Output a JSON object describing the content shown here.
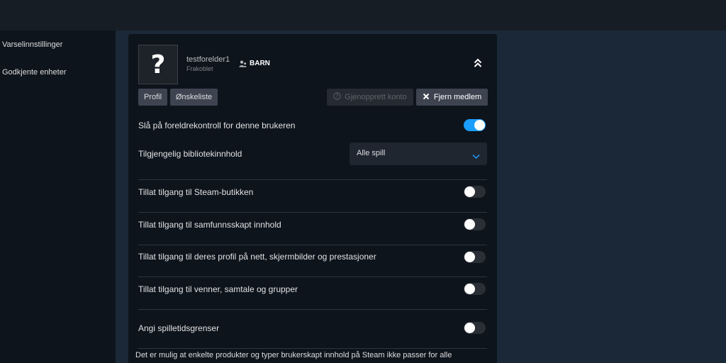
{
  "sidebar": {
    "items": [
      {
        "label": "Varselinnstillinger"
      },
      {
        "label": "Godkjente enheter"
      }
    ]
  },
  "member": {
    "avatar_glyph": "?",
    "username": "testforelder1",
    "status": "Frakoblet",
    "role_badge": "BARN",
    "icons": {
      "role": "child-user-icon",
      "collapse": "double-chevron-up-icon"
    }
  },
  "actions": {
    "profile": "Profil",
    "wishlist": "Ønskeliste",
    "restore": "Gjenopprett konto",
    "remove": "Fjern medlem"
  },
  "settings": {
    "parental_control": {
      "label": "Slå på foreldrekontroll for denne brukeren",
      "enabled": true
    },
    "library": {
      "label": "Tilgjengelig bibliotekinnhold",
      "selected": "Alle spill"
    },
    "toggles": [
      {
        "label": "Tillat tilgang til Steam-butikken",
        "enabled": false
      },
      {
        "label": "Tillat tilgang til samfunnsskapt innhold",
        "enabled": false
      },
      {
        "label": "Tillat tilgang til deres profil på nett, skjermbilder og prestasjoner",
        "enabled": false
      },
      {
        "label": "Tillat tilgang til venner, samtale og grupper",
        "enabled": false
      }
    ],
    "playtime": {
      "label": "Angi spilletidsgrenser",
      "enabled": false
    }
  },
  "footer": {
    "text": "Det er mulig at enkelte produkter og typer brukerskapt innhold på Steam ikke passer for alle"
  },
  "colors": {
    "accent": "#1a9fff",
    "panel": "#0e141b",
    "page": "#1b2838"
  }
}
